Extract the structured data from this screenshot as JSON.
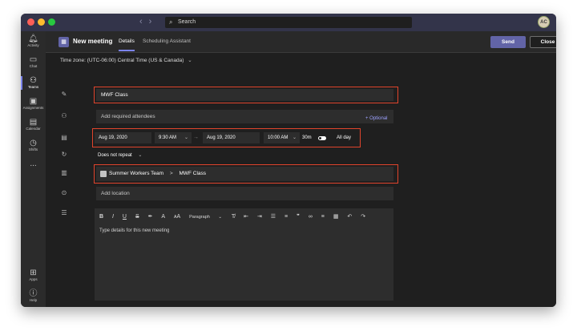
{
  "window": {
    "search_placeholder": "Search",
    "avatar_initials": "AC",
    "traffic_lights": [
      "#ff5f57",
      "#febc2e",
      "#28c840"
    ]
  },
  "rail": {
    "items": [
      {
        "label": "Activity",
        "icon": "bell-icon"
      },
      {
        "label": "Chat",
        "icon": "chat-icon"
      },
      {
        "label": "Teams",
        "icon": "teams-icon",
        "active": true
      },
      {
        "label": "Assignments",
        "icon": "assignments-icon"
      },
      {
        "label": "Calendar",
        "icon": "calendar-icon"
      },
      {
        "label": "Shifts",
        "icon": "shifts-icon"
      },
      {
        "label": "...",
        "icon": "more-icon"
      }
    ],
    "bottom": [
      {
        "label": "Apps",
        "icon": "apps-icon"
      },
      {
        "label": "Help",
        "icon": "help-icon"
      }
    ]
  },
  "header": {
    "title": "New meeting",
    "tabs": [
      {
        "label": "Details",
        "active": true
      },
      {
        "label": "Scheduling Assistant",
        "active": false
      }
    ],
    "send_label": "Send",
    "close_label": "Close"
  },
  "timezone": "Time zone: (UTC-06:00) Central Time (US & Canada)",
  "form": {
    "title_value": "MWF Class",
    "attendees_placeholder": "Add required attendees",
    "optional_label": "+ Optional",
    "start_date": "Aug 19, 2020",
    "start_time": "9:30 AM",
    "end_date": "Aug 19, 2020",
    "end_time": "10:00 AM",
    "duration": "30m",
    "all_day_label": "All day",
    "all_day_on": true,
    "repeat_value": "Does not repeat",
    "channel_team": "Summer Workers Team",
    "channel_separator": ">",
    "channel_name": "MWF Class",
    "location_placeholder": "Add location",
    "details_placeholder": "Type details for this new meeting",
    "paragraph_label": "Paragraph"
  },
  "accent": "#6264a7",
  "highlight": "#e0442c"
}
